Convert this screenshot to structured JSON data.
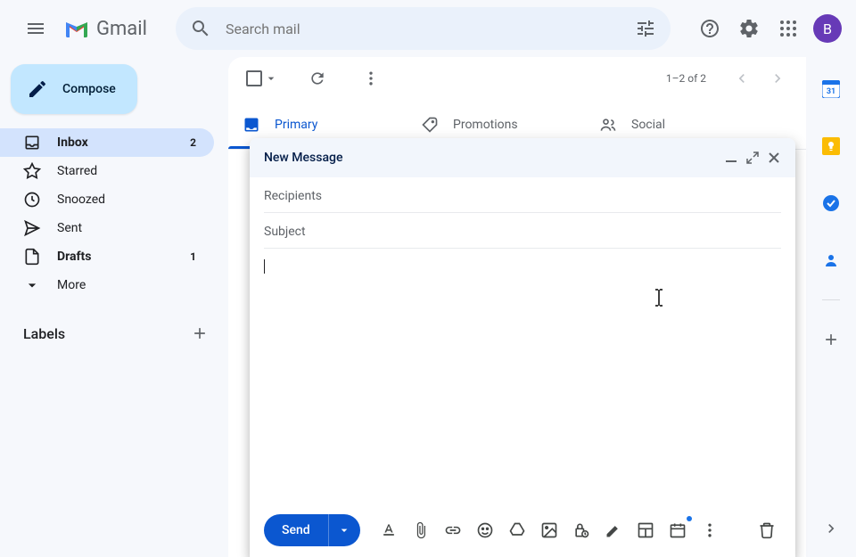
{
  "header": {
    "app_name": "Gmail",
    "search_placeholder": "Search mail",
    "avatar_initial": "B"
  },
  "sidebar": {
    "compose": "Compose",
    "items": [
      {
        "label": "Inbox",
        "count": "2",
        "icon": "inbox"
      },
      {
        "label": "Starred",
        "icon": "star"
      },
      {
        "label": "Snoozed",
        "icon": "clock"
      },
      {
        "label": "Sent",
        "icon": "send"
      },
      {
        "label": "Drafts",
        "count": "1",
        "icon": "draft"
      },
      {
        "label": "More",
        "icon": "expand"
      }
    ],
    "labels_title": "Labels"
  },
  "toolbar": {
    "page_info": "1–2 of 2"
  },
  "tabs": [
    {
      "label": "Primary"
    },
    {
      "label": "Promotions"
    },
    {
      "label": "Social"
    }
  ],
  "compose_dialog": {
    "title": "New Message",
    "recipients_placeholder": "Recipients",
    "subject_placeholder": "Subject",
    "send_label": "Send"
  },
  "side_panel": {
    "calendar_day": "31"
  }
}
